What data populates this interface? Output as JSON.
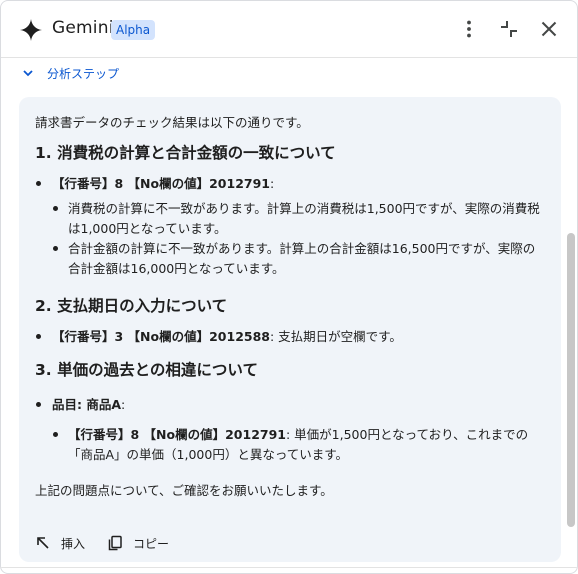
{
  "header": {
    "title": "Gemini",
    "badge": "Alpha",
    "icons": [
      "gemini-sparkle-icon",
      "more-vert-icon",
      "collapse-icon",
      "close-icon"
    ]
  },
  "steps": {
    "label": "分析ステップ"
  },
  "response": {
    "intro": "請求書データのチェック結果は以下の通りです。",
    "section1": {
      "heading": "1. 消費税の計算と合計金額の一致について",
      "item": {
        "strong": "【行番号】8 【No欄の値】2012791",
        "suffix": ":",
        "subitems": [
          "消費税の計算に不一致があります。計算上の消費税は1,500円ですが、実際の消費税は1,000円となっています。",
          "合計金額の計算に不一致があります。計算上の合計金額は16,500円ですが、実際の合計金額は16,000円となっています。"
        ]
      }
    },
    "section2": {
      "heading": "2. 支払期日の入力について",
      "item": {
        "strong": "【行番号】3 【No欄の値】2012588",
        "suffix": ": 支払期日が空欄です。"
      }
    },
    "section3": {
      "heading": "3. 単価の過去との相違について",
      "item": {
        "strong": "品目: 商品A",
        "suffix": ":",
        "sub": {
          "strong": "【行番号】8 【No欄の値】2012791",
          "suffix": ": 単価が1,500円となっており、これまでの「商品A」の単価（1,000円）と異なっています。"
        }
      }
    },
    "outro": "上記の問題点について、ご確認をお願いいたします。",
    "actions": {
      "insert": "挿入",
      "copy": "コピー"
    }
  },
  "colors": {
    "accent": "#0b57d0",
    "badge_bg": "#d3e3fd",
    "card_bg": "#f0f4f9"
  }
}
